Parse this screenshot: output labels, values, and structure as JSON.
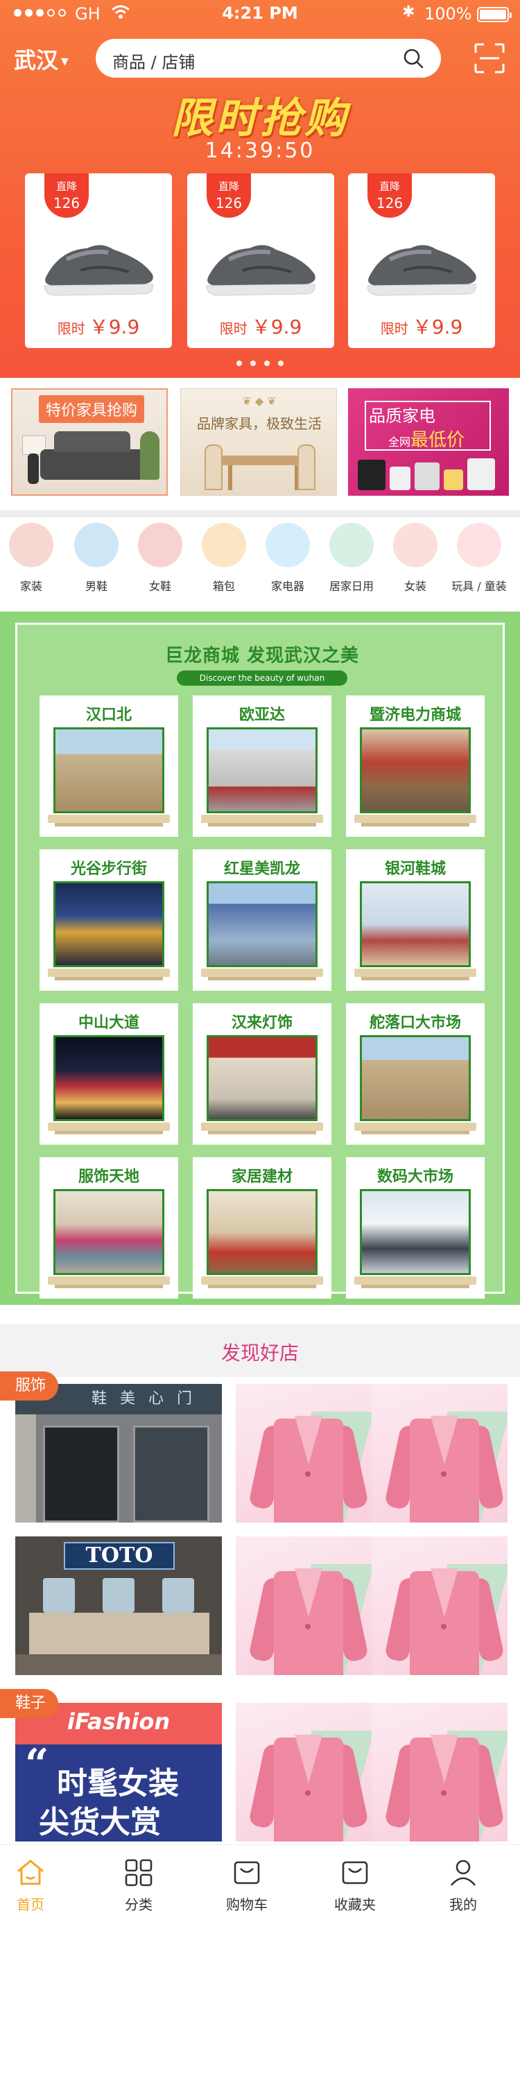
{
  "status_bar": {
    "carrier": "GH",
    "time": "4:21 PM",
    "battery": "100%"
  },
  "header": {
    "city": "武汉",
    "search_placeholder": "商品 / 店铺"
  },
  "flash_sale": {
    "title": "限时抢购",
    "countdown": "14:39:50",
    "items": [
      {
        "badge_top": "直降",
        "badge_value": "126",
        "price_label": "限时",
        "price": "￥9.9"
      },
      {
        "badge_top": "直降",
        "badge_value": "126",
        "price_label": "限时",
        "price": "￥9.9"
      },
      {
        "badge_top": "直降",
        "badge_value": "126",
        "price_label": "限时",
        "price": "￥9.9"
      }
    ]
  },
  "promos": [
    {
      "label": "特价家具抢购"
    },
    {
      "label": "品牌家具，极致生活"
    },
    {
      "label_line1": "品质家电",
      "label_prefix": "全网",
      "label_highlight": "最低价"
    }
  ],
  "categories": [
    {
      "label": "家装",
      "color": "#f7d7d2"
    },
    {
      "label": "男鞋",
      "color": "#cfe6f7"
    },
    {
      "label": "女鞋",
      "color": "#f8d2d2"
    },
    {
      "label": "箱包",
      "color": "#fbe6c4"
    },
    {
      "label": "家电器",
      "color": "#d6eefb"
    },
    {
      "label": "居家日用",
      "color": "#d8f0e3"
    },
    {
      "label": "女装",
      "color": "#fadfdc"
    },
    {
      "label": "玩具 / 童装",
      "color": "#fde2e4"
    }
  ],
  "mall": {
    "title": "巨龙商城   发现武汉之美",
    "subtitle": "Discover the beauty of wuhan",
    "stores": [
      {
        "name": "汉口北"
      },
      {
        "name": "欧亚达"
      },
      {
        "name": "暨济电力商城"
      },
      {
        "name": "光谷步行街"
      },
      {
        "name": "红星美凯龙"
      },
      {
        "name": "银河鞋城"
      },
      {
        "name": "中山大道"
      },
      {
        "name": "汉来灯饰"
      },
      {
        "name": "舵落口大市场"
      },
      {
        "name": "服饰天地"
      },
      {
        "name": "家居建材"
      },
      {
        "name": "数码大市场"
      }
    ]
  },
  "discover": {
    "title": "发现好店",
    "rows": [
      {
        "tag": "服饰"
      },
      {
        "tag": ""
      },
      {
        "tag": "鞋子"
      }
    ]
  },
  "shop_images": {
    "sign1": "鞋 美 心 门",
    "toto": "TOTO",
    "ifashion": "iFashion",
    "fashion_line1": "时髦女装",
    "fashion_line2": "尖货大赏"
  },
  "tabbar": [
    {
      "label": "首页",
      "active": true
    },
    {
      "label": "分类"
    },
    {
      "label": "购物车"
    },
    {
      "label": "收藏夹"
    },
    {
      "label": "我的"
    }
  ]
}
